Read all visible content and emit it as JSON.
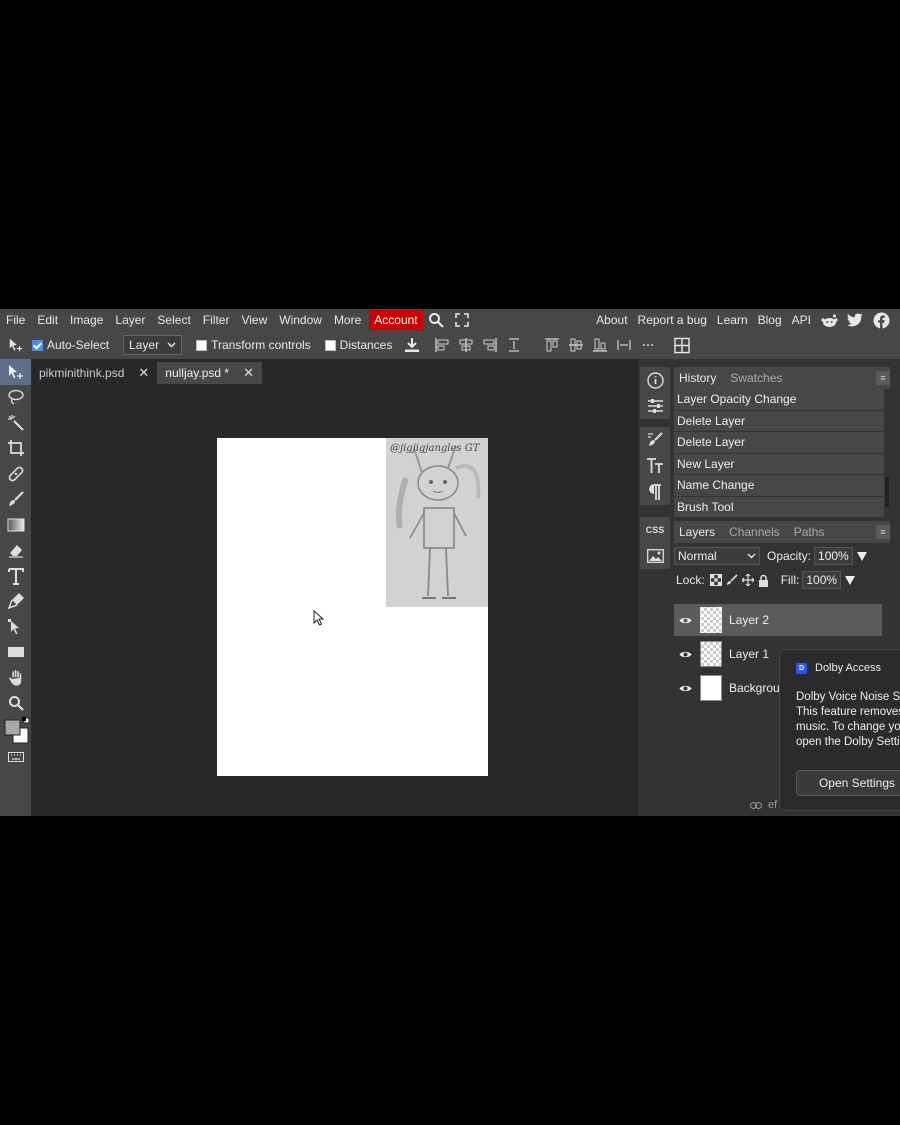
{
  "menu": {
    "items": [
      "File",
      "Edit",
      "Image",
      "Layer",
      "Select",
      "Filter",
      "View",
      "Window",
      "More"
    ],
    "account": "Account",
    "right_links": [
      "About",
      "Report a bug",
      "Learn",
      "Blog",
      "API"
    ]
  },
  "options": {
    "auto_select": "Auto-Select",
    "auto_select_checked": true,
    "layer_select_value": "Layer",
    "transform_controls": "Transform controls",
    "distances": "Distances"
  },
  "tabs": [
    {
      "label": "pikminithink.psd",
      "close": "✕"
    },
    {
      "label": "nulljay.psd *",
      "close": "✕"
    }
  ],
  "canvas": {
    "sketch_signature": "@jigjigjangles GT"
  },
  "history_panel": {
    "tabs": [
      "History",
      "Swatches"
    ],
    "entries": [
      "Layer Opacity Change",
      "Delete Layer",
      "Delete Layer",
      "New Layer",
      "Name Change",
      "Brush Tool"
    ]
  },
  "layers_panel": {
    "tabs": [
      "Layers",
      "Channels",
      "Paths"
    ],
    "blend_mode": "Normal",
    "opacity_label": "Opacity:",
    "opacity_value": "100%",
    "lock_label": "Lock:",
    "fill_label": "Fill:",
    "fill_value": "100%",
    "layers": [
      "Layer 2",
      "Layer 1",
      "Backgrour"
    ],
    "footer_text": "ef"
  },
  "toast": {
    "app_name": "Dolby Access",
    "lines": [
      "Dolby Voice Noise Su",
      "This feature removes",
      "music. To change you",
      "open the Dolby Setti"
    ],
    "button": "Open Settings"
  },
  "side_strip": {
    "css_label": "CSS"
  },
  "colors": {
    "accent_red": "#cc0000",
    "panel_bg": "#474747",
    "workspace_bg": "#282828",
    "active_tool": "#5c6e88"
  }
}
